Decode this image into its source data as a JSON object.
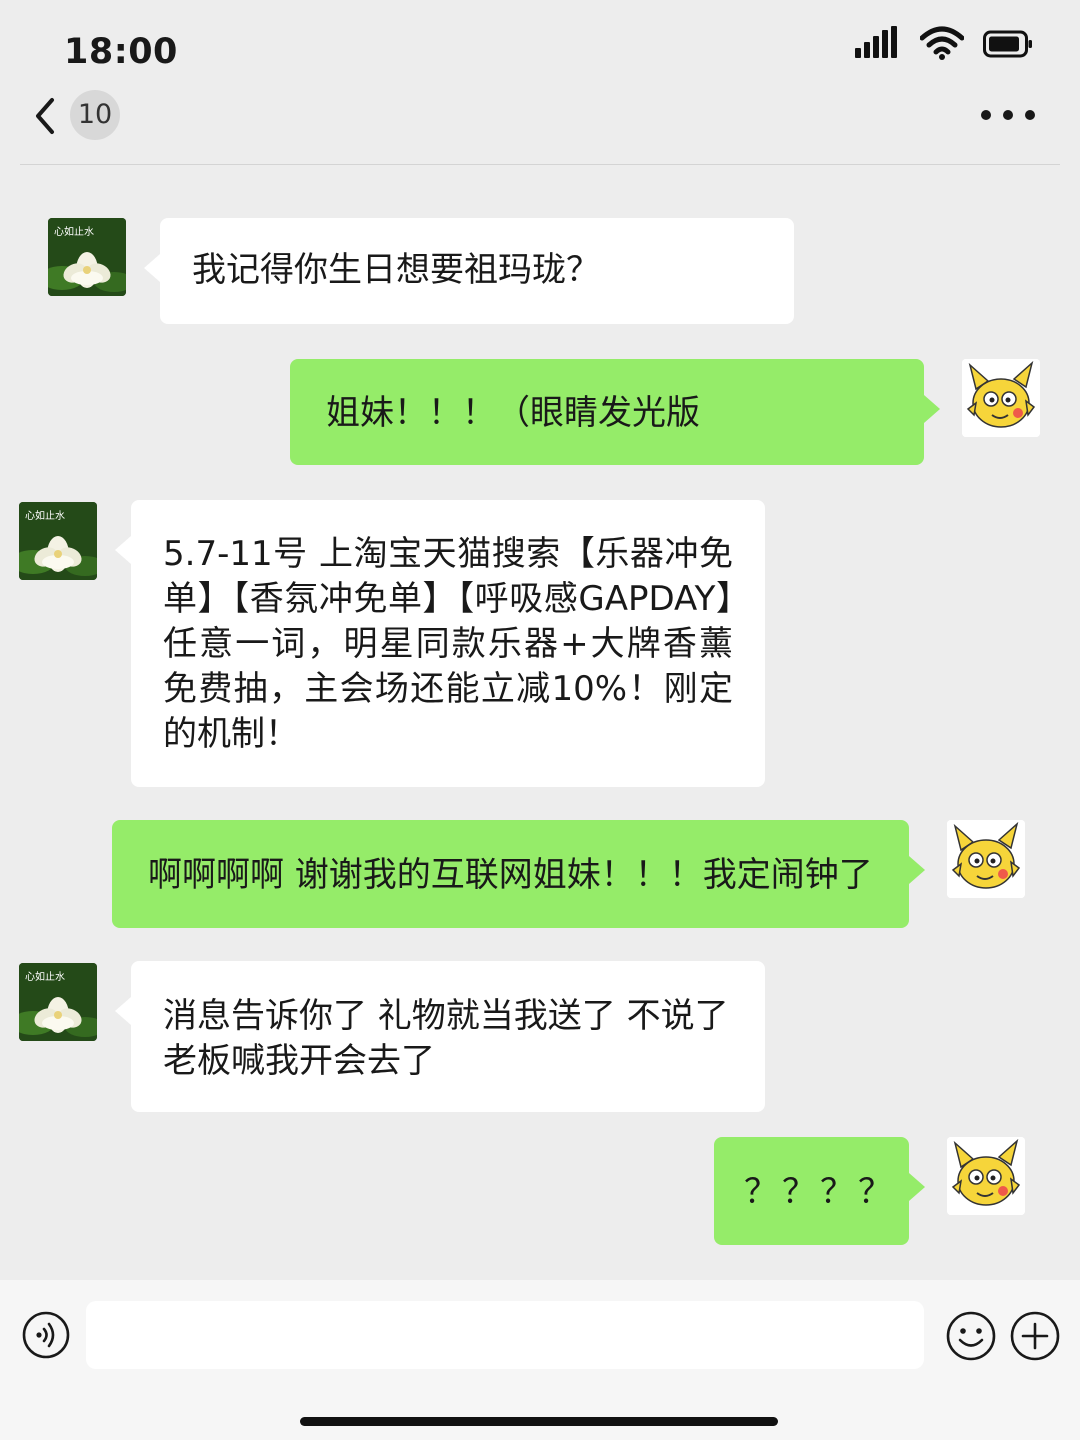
{
  "status_bar": {
    "time": "18:00",
    "icons": [
      "signal-icon",
      "wifi-icon",
      "battery-icon"
    ]
  },
  "nav": {
    "back_icon": "chevron-left-icon",
    "unread_count": "10",
    "more_icon": "more-dots-icon"
  },
  "avatars": {
    "contact_caption": "心如止水"
  },
  "messages": [
    {
      "side": "left",
      "text": "我记得你生日想要祖玛珑？"
    },
    {
      "side": "right",
      "text": "姐妹！！！（眼睛发光版"
    },
    {
      "side": "left",
      "text": "5.7-11号 上淘宝天猫搜索【乐器冲免单】【香氛冲免单】【呼吸感GAPDAY】任意一词，明星同款乐器+大牌香薰免费抽，主会场还能立减10%！刚定的机制！"
    },
    {
      "side": "right",
      "text": "啊啊啊啊 谢谢我的互联网姐妹！！！我定闹钟了"
    },
    {
      "side": "left",
      "text": "消息告诉你了 礼物就当我送了 不说了  老板喊我开会去了"
    },
    {
      "side": "right",
      "text": "？？？？"
    }
  ],
  "input_bar": {
    "voice_icon": "voice-icon",
    "input_value": "",
    "emoji_icon": "emoji-icon",
    "add_icon": "plus-circle-icon"
  },
  "colors": {
    "background": "#ededed",
    "bubble_received": "#ffffff",
    "bubble_sent": "#95ec69"
  }
}
